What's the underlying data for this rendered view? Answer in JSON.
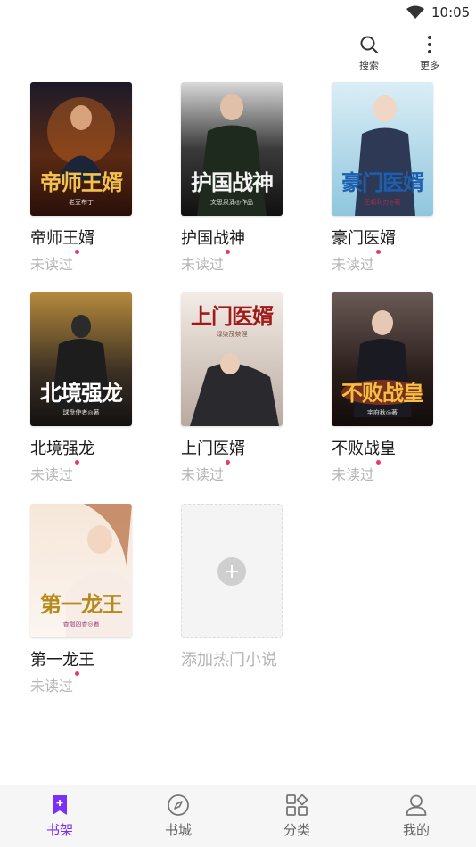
{
  "status_bar": {
    "time": "10:05"
  },
  "header": {
    "search_label": "搜索",
    "more_label": "更多"
  },
  "books": [
    {
      "title": "帝师王婿",
      "cover_title": "帝师王婿",
      "cover_author": "老豆布丁",
      "status": "未读过"
    },
    {
      "title": "护国战神",
      "cover_title": "护国战神",
      "cover_author": "文思泉涌◎作品",
      "status": "未读过"
    },
    {
      "title": "豪门医婿",
      "cover_title": "豪门医婿",
      "cover_author": "王朝利刃◎著",
      "status": "未读过"
    },
    {
      "title": "北境强龙",
      "cover_title": "北境强龙",
      "cover_author": "球盘使者◎著",
      "status": "未读过"
    },
    {
      "title": "上门医婿",
      "cover_title": "上门医婿",
      "cover_author": "绿柒茂茶理",
      "status": "未读过"
    },
    {
      "title": "不败战皇",
      "cover_title": "不败战皇",
      "cover_author": "宅府秋◎著",
      "status": "未读过"
    },
    {
      "title": "第一龙王",
      "cover_title": "第一龙王",
      "cover_author": "香烟凶香◎著",
      "status": "未读过"
    }
  ],
  "add_book": {
    "label": "添加热门小说"
  },
  "bottom_nav": [
    {
      "label": "书架",
      "icon": "bookmark-icon",
      "active": true
    },
    {
      "label": "书城",
      "icon": "compass-icon",
      "active": false
    },
    {
      "label": "分类",
      "icon": "category-icon",
      "active": false
    },
    {
      "label": "我的",
      "icon": "user-icon",
      "active": false
    }
  ],
  "colors": {
    "accent": "#7b2ff7",
    "unread_dot": "#e83a68",
    "muted_text": "#b5b5b5",
    "nav_bg": "#f6f6f6"
  }
}
